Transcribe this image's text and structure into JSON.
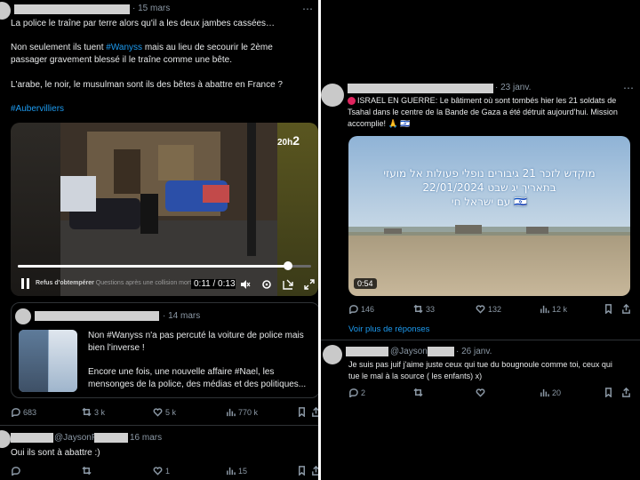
{
  "left": {
    "tweet1": {
      "date": "· 15 mars",
      "line1": "La police le traîne par terre alors qu'il a les deux jambes cassées…",
      "line2_pre": "Non seulement ils tuent ",
      "line2_tag": "#Wanyss",
      "line2_post": " mais au lieu de secourir le 2ème",
      "line3": "passager gravement blessé il le traîne comme une bête.",
      "line4": "L'arabe, le noir, le musulman sont ils des bêtes à abattre en France ?",
      "hashtag": "#Aubervilliers",
      "video": {
        "channel": "20h",
        "channel_num": "2",
        "caption": "Refus d'obtempérer",
        "caption_sub": "Questions après une collision mortelle...",
        "time": "0:11 / 0:13",
        "progress": 0.92
      }
    },
    "quote": {
      "date": "· 14 mars",
      "line1": "Non #Wanyss n'a pas percuté la voiture de police mais",
      "line2": "bien l'inverse !",
      "line3": "Encore une fois, une nouvelle affaire #Nael, les",
      "line4": "mensonges de la police, des médias et des politiques..."
    },
    "stats": {
      "replies": "683",
      "reposts": "3 k",
      "likes": "5 k",
      "views": "770 k"
    },
    "reply": {
      "handle": "@JaysonP",
      "date": "16 mars",
      "text": "Oui ils sont à abattre :)",
      "likes": "1",
      "views": "15"
    }
  },
  "right": {
    "tweet": {
      "date": "· 23 janv.",
      "line1": "ISRAEL EN GUERRE: Le bâtiment où sont tombés hier les 21 soldats de",
      "line2": "Tsahal dans le centre de la Bande de Gaza a été détruit aujourd'hui. Mission",
      "line3": "accomplie! 🙏 🇮🇱",
      "video": {
        "overlay1": "מוקדש לזכר 21 גיבורים נופלי פעולות אל מועזי",
        "overlay2": "בתאריך יג שבט 22/01/2024",
        "overlay3": "עם ישראל חי 🇮🇱",
        "duration": "0:54"
      },
      "stats": {
        "replies": "146",
        "reposts": "33",
        "likes": "132",
        "views": "12 k"
      }
    },
    "more_replies": "Voir plus de réponses",
    "reply": {
      "handle": "@JaysonP",
      "date": "· 26 janv.",
      "line1": "Je suis pas juif j'aime juste ceux qui tue du bougnoule comme toi, ceux qui",
      "line2": "tue le mal à la source ( les enfants) x)",
      "replies": "2",
      "views": "20"
    }
  },
  "colors": {
    "bg": "#000000",
    "text": "#e7e9ea",
    "muted": "#8b98a5",
    "link": "#1d9bf0",
    "redaction": "#d0d0d0"
  }
}
